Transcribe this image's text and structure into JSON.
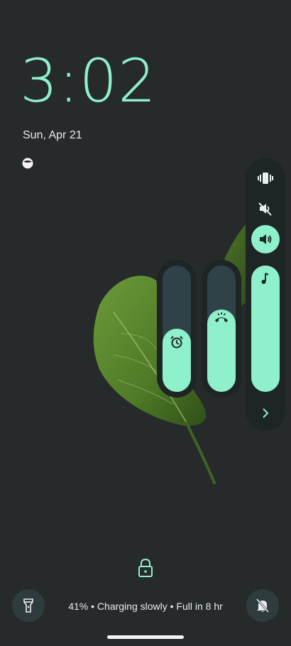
{
  "lockscreen": {
    "time": "3:02",
    "date": "Sun, Apr 21",
    "weather_icon": "weather-moon-icon"
  },
  "volume_panel": {
    "ringer_modes": [
      {
        "name": "vibrate",
        "icon": "vibrate-icon",
        "active": false
      },
      {
        "name": "mute",
        "icon": "speaker-muted-icon",
        "active": false
      },
      {
        "name": "ring",
        "icon": "speaker-on-icon",
        "active": true
      }
    ],
    "sliders": [
      {
        "name": "media",
        "icon": "music-note-icon",
        "level": 1.0
      },
      {
        "name": "call",
        "icon": "phone-icon",
        "level": 0.65
      },
      {
        "name": "alarm",
        "icon": "alarm-clock-icon",
        "level": 0.5
      }
    ],
    "expand_icon": "chevron-right-icon"
  },
  "bottom": {
    "charging_text": "41% • Charging slowly • Full in 8 hr",
    "left_shortcut_icon": "flashlight-icon",
    "right_shortcut_icon": "notifications-off-icon",
    "lock_icon": "lock-icon"
  },
  "colors": {
    "accent": "#8ff0cc",
    "background": "#262a2a",
    "panel": "#1e2525",
    "track": "#2f4248"
  }
}
